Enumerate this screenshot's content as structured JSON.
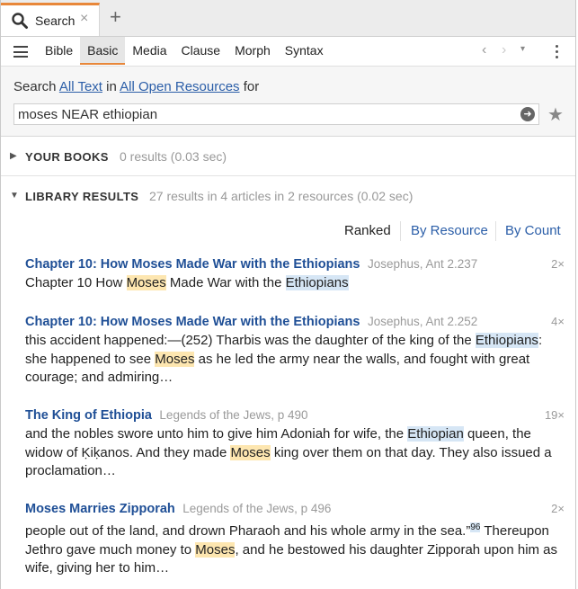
{
  "tab": {
    "label": "Search",
    "close": "×",
    "add": "+"
  },
  "toolbar": {
    "modes": [
      "Bible",
      "Basic",
      "Media",
      "Clause",
      "Morph",
      "Syntax"
    ],
    "active_mode": "Basic",
    "back": "‹",
    "forward": "›",
    "dropdown": "▾"
  },
  "search": {
    "prefix": "Search",
    "scope": "All Text",
    "in": "in",
    "resources": "All Open Resources",
    "for": "for",
    "query": "moses NEAR ethiopian"
  },
  "your_books": {
    "title": "YOUR BOOKS",
    "meta": "0 results (0.03 sec)"
  },
  "library": {
    "title": "LIBRARY RESULTS",
    "meta": "27 results in 4 articles in 2 resources (0.02 sec)"
  },
  "sort": {
    "ranked": "Ranked",
    "by_resource": "By Resource",
    "by_count": "By Count"
  },
  "results": [
    {
      "title": "Chapter 10: How Moses Made War with the Ethiopians",
      "source": "Josephus, Ant 2.237",
      "count": "2×",
      "t0": "Chapter 10 How ",
      "m1": "Moses",
      "t1": " Made War with the ",
      "e1": "Ethiopians"
    },
    {
      "title": "Chapter 10: How Moses Made War with the Ethiopians",
      "source": "Josephus, Ant 2.252",
      "count": "4×",
      "t0": "this accident happened:—(252) Tharbis was the daughter of the king of the ",
      "e1": "Ethiopians",
      "t1": ": she happened to see ",
      "m1": "Moses",
      "t2": " as he led the army near the walls, and fought with great courage; and admiring…"
    },
    {
      "title": "The King of Ethiopia",
      "source": "Legends of the Jews, p 490",
      "count": "19×",
      "t0": "and the nobles swore unto him to give him Adoniah for wife, the ",
      "e1": "Ethiopian",
      "t1": " queen, the widow of Ḳiḳanos. And they made ",
      "m1": "Moses",
      "t2": " king over them on that day. They also issued a proclamation…"
    },
    {
      "title": "Moses Marries Zipporah",
      "source": "Legends of the Jews, p 496",
      "count": "2×",
      "t0": "people out of the land, and drown Pharaoh and his whole army in the sea.”",
      "sup": "96",
      "t1": " Thereupon Jethro gave much money to ",
      "m1": "Moses",
      "t2": ", and he bestowed his daughter Zipporah upon him as wife, giving her to him…"
    }
  ],
  "colors": {
    "accent": "#e8873a",
    "link": "#1f4f96",
    "moses_highlight": "#fde6b0",
    "ethiopian_highlight": "#d6e6f5"
  }
}
